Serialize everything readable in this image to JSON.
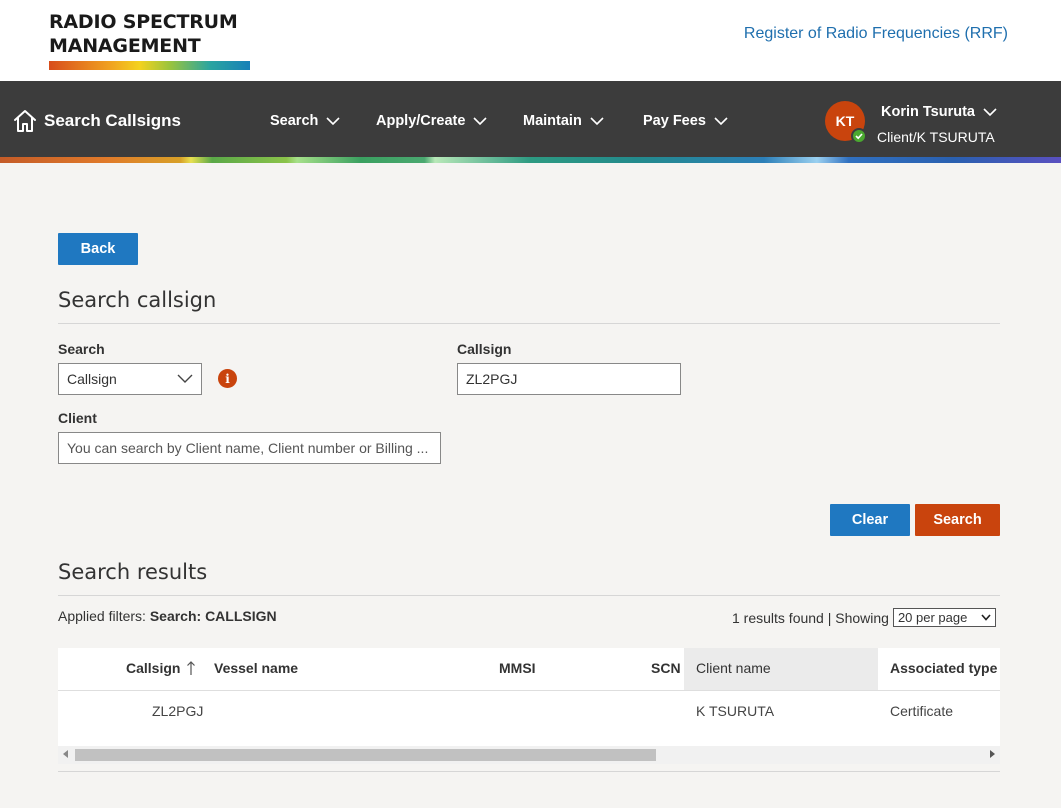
{
  "brand": {
    "logo_line1": "RADIO SPECTRUM",
    "logo_line2": "MANAGEMENT",
    "rrf_link": "Register of Radio Frequencies (RRF)"
  },
  "nav": {
    "home_label": "Search Callsigns",
    "menu": [
      {
        "label": "Search"
      },
      {
        "label": "Apply/Create"
      },
      {
        "label": "Maintain"
      },
      {
        "label": "Pay Fees"
      }
    ],
    "user": {
      "initials": "KT",
      "name": "Korin Tsuruta",
      "role": "Client/K TSURUTA"
    }
  },
  "main": {
    "back_label": "Back",
    "section_title": "Search callsign",
    "search_label": "Search",
    "search_select_value": "Callsign",
    "info_icon": "i",
    "callsign_label": "Callsign",
    "callsign_value": "ZL2PGJ",
    "client_label": "Client",
    "client_placeholder": "You can search by Client name, Client number or Billing ...",
    "clear_label": "Clear",
    "search_button_label": "Search"
  },
  "results": {
    "title": "Search results",
    "applied_prefix": "Applied filters:",
    "applied_value": "Search: CALLSIGN",
    "count_text": "1 results found | Showing",
    "per_page": "20 per page",
    "columns": [
      "Callsign",
      "Vessel name",
      "MMSI",
      "SCN",
      "Client name",
      "Associated type"
    ],
    "rows": [
      {
        "callsign": "ZL2PGJ",
        "vessel": "",
        "mmsi": "",
        "scn": "",
        "client": "K TSURUTA",
        "type": "Certificate"
      }
    ]
  },
  "colors": {
    "accent_blue": "#1f78c1",
    "accent_orange": "#c9440d",
    "nav_bg": "#3c3c3c"
  }
}
